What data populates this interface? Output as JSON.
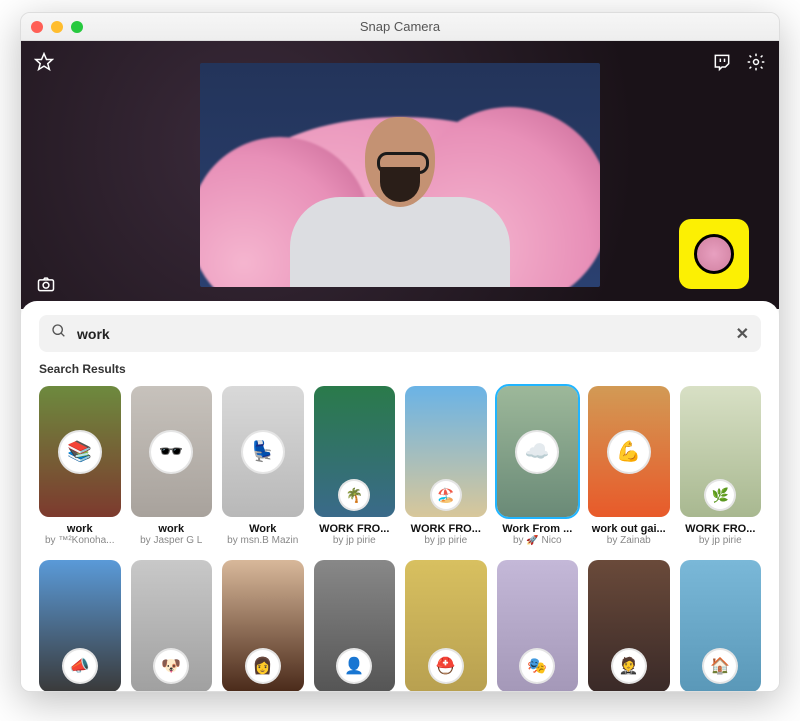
{
  "window": {
    "title": "Snap Camera"
  },
  "search": {
    "value": "work",
    "results_label": "Search Results"
  },
  "lenses_row1": [
    {
      "title": "work",
      "author": "by ™²Konoha...",
      "bg": "linear-gradient(#6d8a3e,#7d3a2e)",
      "icon": "📚",
      "selected": false,
      "circle_pos": "center"
    },
    {
      "title": "work",
      "author": "by Jasper G L",
      "bg": "linear-gradient(#c7c2bc,#a8a29c)",
      "icon": "🕶️",
      "selected": false,
      "circle_pos": "center"
    },
    {
      "title": "Work",
      "author": "by msn.B Mazin",
      "bg": "linear-gradient(#d9d9d9,#b8b8b8)",
      "icon": "💺",
      "selected": false,
      "circle_pos": "center"
    },
    {
      "title": "WORK FRO...",
      "author": "by jp pirie",
      "bg": "linear-gradient(#2a7a4a,#3a6a8a)",
      "icon": "🌴",
      "selected": false,
      "circle_pos": "bottom"
    },
    {
      "title": "WORK FRO...",
      "author": "by jp pirie",
      "bg": "linear-gradient(#6ab3e6,#d8c79a)",
      "icon": "🏖️",
      "selected": false,
      "circle_pos": "bottom"
    },
    {
      "title": "Work From ...",
      "author": "by 🚀 Nico",
      "bg": "linear-gradient(#9db89a,#6a8a77)",
      "icon": "☁️",
      "selected": true,
      "circle_pos": "center"
    },
    {
      "title": "work out gai...",
      "author": "by Zainab",
      "bg": "linear-gradient(#d29a55,#e85a2a)",
      "icon": "💪",
      "selected": false,
      "circle_pos": "center"
    },
    {
      "title": "WORK FRO...",
      "author": "by jp pirie",
      "bg": "linear-gradient(#d8e0c5,#a8b890)",
      "icon": "🌿",
      "selected": false,
      "circle_pos": "bottom"
    }
  ],
  "lenses_row2": [
    {
      "bg": "linear-gradient(#5a9ad8,#3a3a3a)",
      "icon": "📣"
    },
    {
      "bg": "linear-gradient(#c8c8c8,#a0a0a0)",
      "icon": "🐶"
    },
    {
      "bg": "linear-gradient(#d8b89a,#4a2a1a)",
      "icon": "👩"
    },
    {
      "bg": "linear-gradient(#888,#555)",
      "icon": "👤"
    },
    {
      "bg": "linear-gradient(#d8c060,#b8a050)",
      "icon": "⛑️"
    },
    {
      "bg": "linear-gradient(#c4b8d8,#a498b8)",
      "icon": "🎭"
    },
    {
      "bg": "linear-gradient(#6a4a3a,#3a2a28)",
      "icon": "🤵"
    },
    {
      "bg": "linear-gradient(#7ab8d8,#5a98b8)",
      "icon": "🏠"
    }
  ]
}
